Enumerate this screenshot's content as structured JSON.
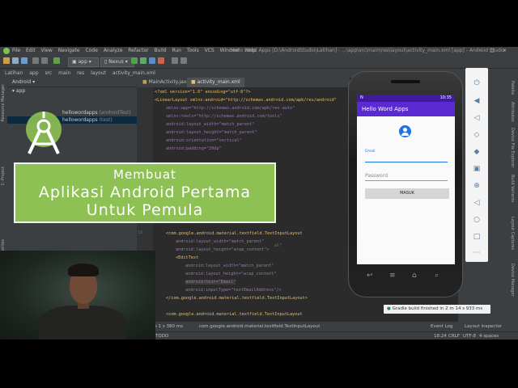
{
  "ide": {
    "title": "Hello Word Apps [D:\\AndroidStudio\\Latihan] - ...\\app\\src\\main\\res\\layout\\activity_main.xml [app] - Android Studio",
    "menu": [
      "File",
      "Edit",
      "View",
      "Navigate",
      "Code",
      "Analyze",
      "Refactor",
      "Build",
      "Run",
      "Tools",
      "VCS",
      "Window",
      "Help"
    ],
    "run_config": "app",
    "device": "Nexus",
    "breadcrumbs": [
      "Latihan",
      "app",
      "src",
      "main",
      "res",
      "layout"
    ],
    "breadcrumb_file": "activity_main.xml",
    "project_view": "Android",
    "tree": [
      {
        "label": "app",
        "note": ""
      },
      {
        "label": "hellowordapps",
        "note": "(androidTest)"
      },
      {
        "label": "hellowordapps",
        "note": "(test)"
      },
      {
        "label": "res",
        "note": ""
      }
    ],
    "tabs": [
      "MainActivity.java",
      "activity_main.xml"
    ],
    "side_tabs_left": [
      "1: Project",
      "Resource Manager",
      "2: Favorites"
    ],
    "side_tabs_right": [
      "Palette",
      "Attributes",
      "Device File Explorer",
      "Build Variants",
      "Layout Captures",
      "Device Manager"
    ],
    "line_numbers": [
      "18"
    ],
    "code": {
      "xml_decl": "<?xml version=\"1.0\" encoding=\"utf-8\"?>",
      "ll_open": "<LinearLayout xmlns:android=\"http://schemas.android.com/apk/res/android\"",
      "xmlns_app": "xmlns:app=\"http://schemas.android.com/apk/res-auto\"",
      "xmlns_tools": "xmlns:tools=\"http://schemas.android.com/tools\"",
      "lw": "android:layout_width=\"match_parent\"",
      "lh": "android:layout_height=\"match_parent\"",
      "orient": "android:orientation=\"vertical\"",
      "pad": "android:padding=\"20dp\"",
      "al": "al\"",
      "til_open": "<com.google.android.material.textfield.TextInputLayout",
      "til_lw": "android:layout_width=\"match_parent\"",
      "til_lh": "android:layout_height=\"wrap_content\">",
      "et_open": "<EditText",
      "et_lw": "android:layout_width=\"match_parent\"",
      "et_lh": "android:layout_height=\"wrap_content\"",
      "et_hint": "android:hint=\"Email\"",
      "et_input": "android:inputType=\"textEmailAddress\"/>",
      "til_close": "</com.google.android.material.textfield.TextInputLayout>",
      "til_open2": "<com.google.android.material.textfield.TextInputLayout"
    },
    "bottom_path": "com.google.android.material.textfield.TextInputLayout",
    "build_time": "s 1 s 380 ms",
    "todo": "TODO",
    "event_log": "Event Log",
    "layout_inspector": "Layout Inspector",
    "status_pos": "18:24",
    "status_crlf": "CRLF",
    "status_enc": "UTF-8",
    "status_indent": "4 spaces",
    "toast": "Gradle build finished in 2 m 14 s 933 ms"
  },
  "emulator": {
    "status_time": "10:35",
    "status_left": "N",
    "app_title": "Hello Word Apps",
    "email_label": "Email",
    "password_hint": "Password",
    "button_label": "MASUK"
  },
  "banner": {
    "line1": "Membuat",
    "line2": "Aplikasi Android Pertama",
    "line3": "Untuk Pemula"
  },
  "colors": {
    "banner_green": "#8ec153",
    "app_purple": "#5b2bd1",
    "status_purple": "#3f1c9e",
    "accent_blue": "#1a73e8"
  }
}
